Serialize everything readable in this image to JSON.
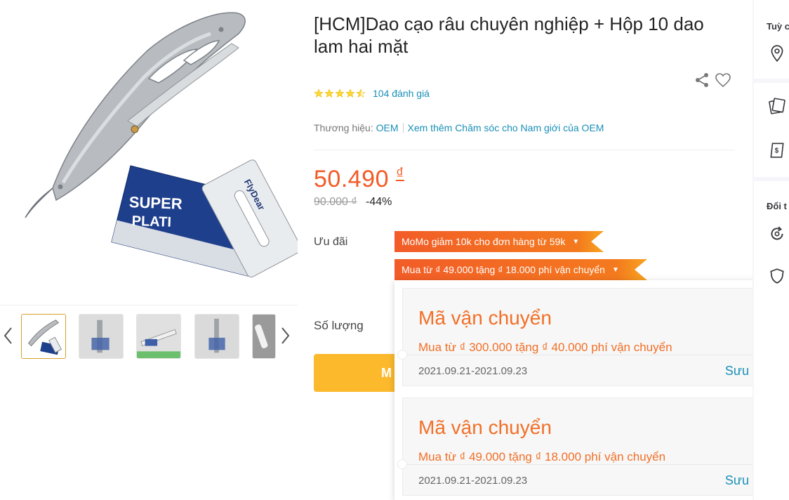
{
  "product": {
    "title": "[HCM]Dao cạo râu chuyên nghiệp + Hộp 10 dao lam hai mặt",
    "rating": 4.5,
    "review_count_text": "104 đánh giá",
    "brand_label": "Thương hiệu:",
    "brand_name": "OEM",
    "brand_more_link": "Xem thêm Chăm sóc cho Nam giới của OEM",
    "price": "50.490",
    "currency": "₫",
    "old_price": "90.000 ₫",
    "discount": "-44%"
  },
  "offers": {
    "label": "Ưu đãi",
    "tags": [
      "MoMo giảm 10k cho đơn hàng từ 59k",
      "Mua từ ₫ 49.000 tặng ₫ 18.000 phí vận chuyển"
    ]
  },
  "quantity": {
    "label": "Số lượng"
  },
  "buy_button": {
    "label": "M"
  },
  "vouchers": [
    {
      "title": "Mã vận chuyển",
      "desc": "Mua từ ₫ 300.000 tặng ₫ 40.000 phí vận chuyển",
      "date": "2021.09.21-2021.09.23",
      "action": "Sưu tầm"
    },
    {
      "title": "Mã vận chuyển",
      "desc": "Mua từ ₫ 49.000 tặng ₫ 18.000 phí vận chuyển",
      "date": "2021.09.21-2021.09.23",
      "action": "Sưu tầm"
    }
  ],
  "sidebar": {
    "label_1": "Tuỳ c",
    "label_2": "Đổi t"
  },
  "colors": {
    "price": "#f25a26",
    "link": "#1a8fb8",
    "star": "#fdd836",
    "buy": "#fcb92c"
  },
  "icons": [
    "chevron-left-icon",
    "chevron-right-icon",
    "share-icon",
    "heart-icon",
    "location-pin-icon",
    "cards-icon",
    "receipt-icon",
    "refresh-icon",
    "shield-icon"
  ]
}
